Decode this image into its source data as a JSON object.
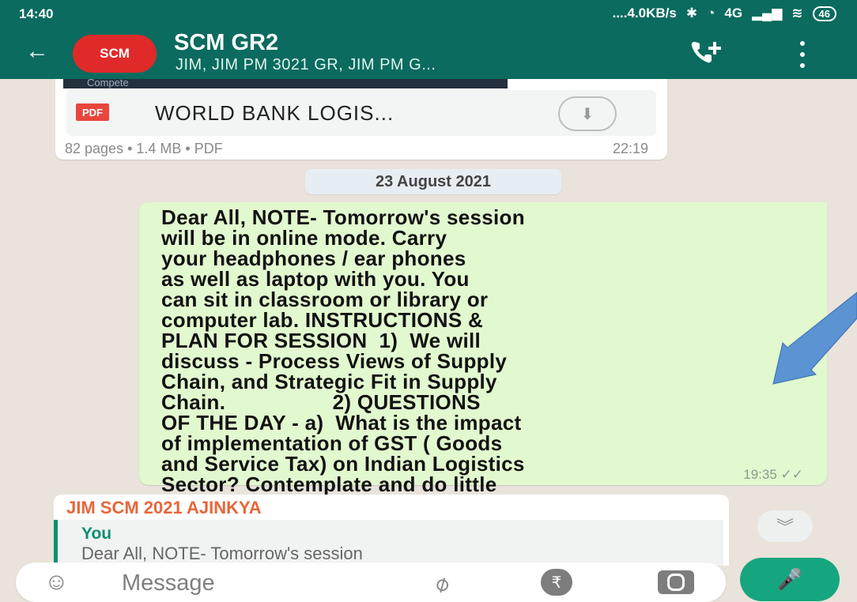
{
  "status_bar": {
    "time": "14:40",
    "network": "....4.0KB/s",
    "signal": "4G",
    "battery": "46"
  },
  "header": {
    "avatar_text": "SCM",
    "title": "SCM GR2",
    "subtitle": "JIM, JIM PM 3021 GR, JIM PM G...",
    "back_icon": "back-arrow-icon",
    "call_icon": "add-call-icon",
    "menu_icon": "more-vertical-icon"
  },
  "pdf_message": {
    "thumb_text": "Compete",
    "badge": "PDF",
    "file_name": "WORLD BANK LOGIS...",
    "meta": "82 pages • 1.4 MB • PDF",
    "time": "22:19"
  },
  "date_chip": "23 August 2021",
  "outgoing_message": {
    "text": "Dear All, NOTE- Tomorrow's session\nwill be in online mode. Carry\nyour headphones / ear phones\nas well as laptop with you. You\ncan sit in classroom or library or\ncomputer lab. INSTRUCTIONS &\nPLAN FOR SESSION  1)  We will\ndiscuss - Process Views of Supply\nChain, and Strategic Fit in Supply\nChain.                  2) QUESTIONS\nOF THE DAY - a)  What is the impact\nof implementation of GST ( Goods\nand Service Tax) on Indian Logistics\nSector? Contemplate and do little\nresearch on this question.",
    "time": "19:35 ✓✓"
  },
  "incoming_message": {
    "sender": "JIM SCM 2021 AJINKYA",
    "reply_author": "You",
    "reply_snippet": "Dear All, NOTE- Tomorrow's session"
  },
  "composer": {
    "placeholder": "Message",
    "emoji_icon": "emoji-icon",
    "attach_icon": "paperclip-icon",
    "payment_icon": "rupee-icon",
    "camera_icon": "camera-icon",
    "mic_icon": "mic-icon"
  },
  "colors": {
    "header": "#0a6b5e",
    "outgoing_bubble": "#e2f8cf",
    "sender_name": "#e8663a",
    "accent": "#16a67f",
    "annotation_arrow": "#5b93d3"
  }
}
